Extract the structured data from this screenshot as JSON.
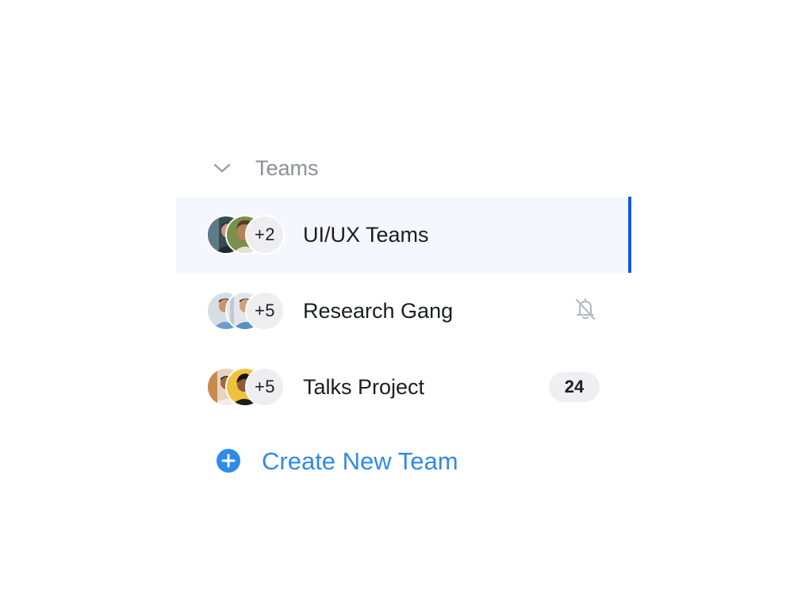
{
  "section": {
    "title": "Teams",
    "collapse_icon": "chevron-down-icon"
  },
  "teams": [
    {
      "name": "UI/UX Teams",
      "extra_members": "+2",
      "active": true
    },
    {
      "name": "Research Gang",
      "extra_members": "+5",
      "muted_icon": "bell-off-icon"
    },
    {
      "name": "Talks Project",
      "extra_members": "+5",
      "unread_count": "24"
    }
  ],
  "create": {
    "label": "Create New Team",
    "icon": "plus-circle-icon"
  },
  "colors": {
    "active_bg": "#f4f8fe",
    "active_indicator": "#1a56e6",
    "link": "#2f8ae8",
    "muted_text": "#8c8f98"
  }
}
